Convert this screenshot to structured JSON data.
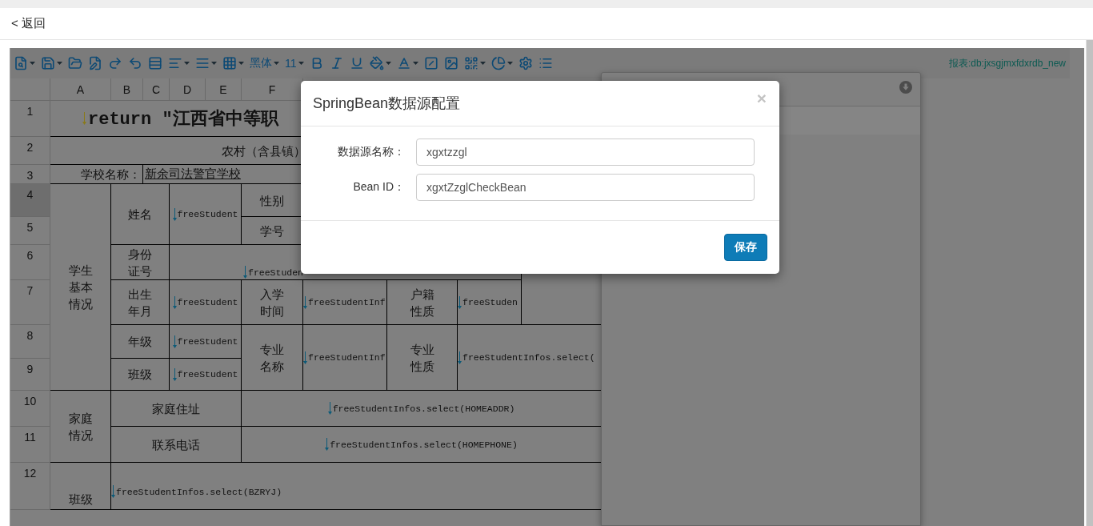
{
  "top_bar": {
    "back": "< 返回"
  },
  "toolbar": {
    "font": "黑体",
    "font_size": "11",
    "report_label": "报表:db:jxsgjmxfdxrdb_new"
  },
  "sheet": {
    "columns": [
      "A",
      "B",
      "C",
      "D",
      "E",
      "F"
    ],
    "rows": [
      {
        "label": "1",
        "selected": false
      },
      {
        "label": "2",
        "selected": false
      },
      {
        "label": "3",
        "selected": false
      },
      {
        "label": "4",
        "selected": true
      },
      {
        "label": "5",
        "selected": false
      },
      {
        "label": "6",
        "selected": false
      },
      {
        "label": "7",
        "selected": false
      },
      {
        "label": "8",
        "selected": false
      },
      {
        "label": "9",
        "selected": false
      },
      {
        "label": "10",
        "selected": false
      },
      {
        "label": "11",
        "selected": false
      },
      {
        "label": "12",
        "selected": false
      }
    ],
    "cells": [
      {
        "kind": "expression",
        "text": "return \"江西省中等职"
      },
      {
        "kind": "label",
        "text": "农村（含县镇）"
      },
      {
        "kind": "label",
        "text": "学校名称："
      },
      {
        "kind": "link",
        "text": "新余司法警官学校"
      },
      {
        "kind": "label",
        "text": "学生基本情况"
      },
      {
        "kind": "label",
        "text": "姓名"
      },
      {
        "kind": "field",
        "text": "freeStudent"
      },
      {
        "kind": "label",
        "text": "性别"
      },
      {
        "kind": "label",
        "text": "学号"
      },
      {
        "kind": "label",
        "text": "身份证号"
      },
      {
        "kind": "field",
        "text": "freeStuden"
      },
      {
        "kind": "label",
        "text": "出生年月"
      },
      {
        "kind": "field",
        "text": "freeStudent"
      },
      {
        "kind": "label",
        "text": "入学时间"
      },
      {
        "kind": "field",
        "text": "freeStudentInf"
      },
      {
        "kind": "label",
        "text": "户籍性质"
      },
      {
        "kind": "field",
        "text": "freeStuden"
      },
      {
        "kind": "label",
        "text": "年级"
      },
      {
        "kind": "field",
        "text": "freeStudent"
      },
      {
        "kind": "label",
        "text": "专业名称"
      },
      {
        "kind": "field",
        "text": "freeStudentInf"
      },
      {
        "kind": "label",
        "text": "专业性质"
      },
      {
        "kind": "field",
        "text": "freeStudentInfos.select("
      },
      {
        "kind": "label",
        "text": "班级"
      },
      {
        "kind": "field",
        "text": "freeStudent"
      },
      {
        "kind": "label",
        "text": "家庭情况"
      },
      {
        "kind": "label",
        "text": "家庭住址"
      },
      {
        "kind": "field",
        "text": "freeStudentInfos.select(HOMEADDR)"
      },
      {
        "kind": "label",
        "text": "联系电话"
      },
      {
        "kind": "field",
        "text": "freeStudentInfos.select(HOMEPHONE)"
      },
      {
        "kind": "label",
        "text": "班级"
      },
      {
        "kind": "field",
        "text": "freeStudentInfos.select(BZRYJ)"
      }
    ]
  },
  "dialog": {
    "title": "SpringBean数据源配置",
    "close": "×",
    "fields": [
      {
        "label": "数据源名称：",
        "value": "xgxtzzgl"
      },
      {
        "label": "Bean ID：",
        "value": "xgxtZzglCheckBean"
      }
    ],
    "button": "保存"
  }
}
